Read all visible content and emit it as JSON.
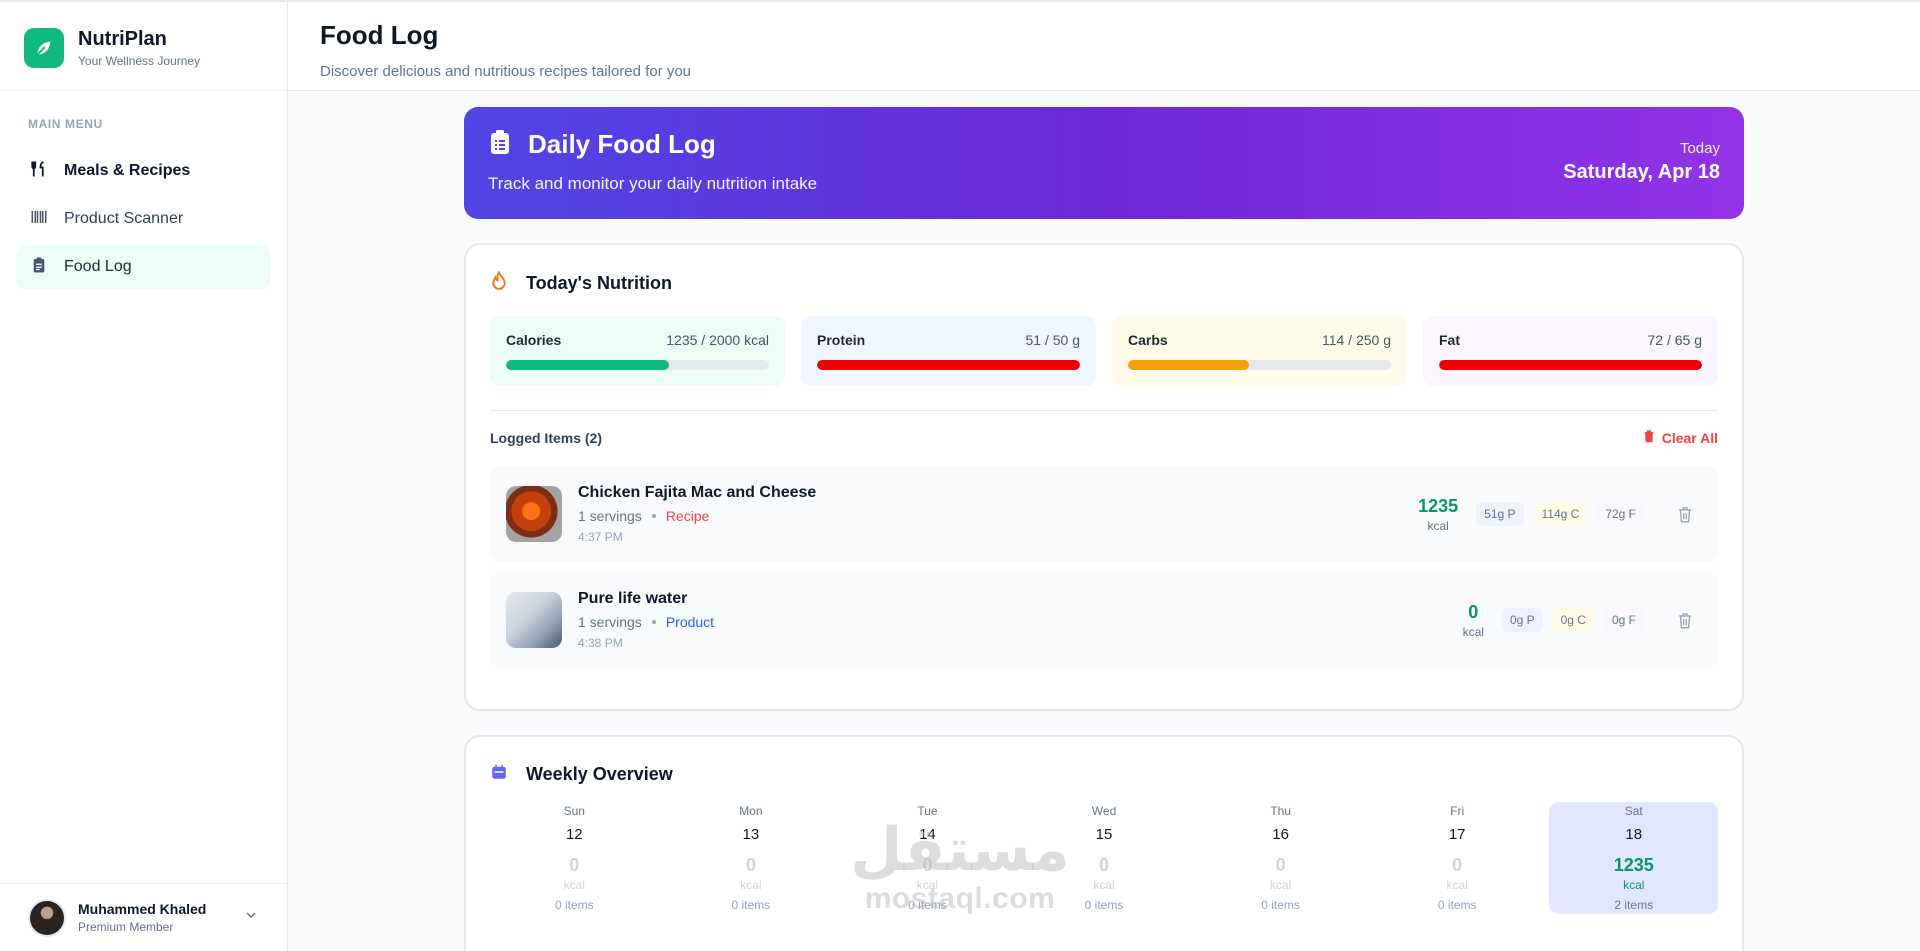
{
  "brand": {
    "name": "NutriPlan",
    "tagline": "Your Wellness Journey",
    "logo_icon": "leaf-icon",
    "accent": "#10b981"
  },
  "sidebar": {
    "heading": "MAIN MENU",
    "items": [
      {
        "label": "Meals & Recipes",
        "icon": "utensils-icon"
      },
      {
        "label": "Product Scanner",
        "icon": "barcode-icon"
      },
      {
        "label": "Food Log",
        "icon": "clipboard-icon",
        "selected": true
      }
    ],
    "user": {
      "name": "Muhammed Khaled",
      "role": "Premium Member"
    }
  },
  "header": {
    "title": "Food Log",
    "subtitle": "Discover delicious and nutritious recipes tailored for you"
  },
  "hero": {
    "title": "Daily Food Log",
    "subtitle": "Track and monitor your daily nutrition intake",
    "day_label": "Today",
    "date": "Saturday, Apr 18"
  },
  "nutrition": {
    "title": "Today's Nutrition",
    "macros": [
      {
        "name": "Calories",
        "value": "1235 / 2000 kcal",
        "progress": 0.62,
        "color": "#10b981",
        "bg": "#ecfdf5"
      },
      {
        "name": "Protein",
        "value": "51 / 50 g",
        "progress": 1.0,
        "color": "#ef0000",
        "bg": "#eff6ff"
      },
      {
        "name": "Carbs",
        "value": "114 / 250 g",
        "progress": 0.46,
        "color": "#f59e0b",
        "bg": "#fefce8"
      },
      {
        "name": "Fat",
        "value": "72 / 65 g",
        "progress": 1.0,
        "color": "#ef0000",
        "bg": "#faf5ff"
      }
    ],
    "logged_title": "Logged Items (2)",
    "clear_label": "Clear All",
    "items": [
      {
        "name": "Chicken Fajita Mac and Cheese",
        "servings": "1 servings",
        "type": "Recipe",
        "time": "4:37 PM",
        "kcal": "1235",
        "kcal_unit": "kcal",
        "p": "51g P",
        "c": "114g C",
        "f": "72g F"
      },
      {
        "name": "Pure life water",
        "servings": "1 servings",
        "type": "Product",
        "time": "4:38 PM",
        "kcal": "0",
        "kcal_unit": "kcal",
        "p": "0g P",
        "c": "0g C",
        "f": "0g F"
      }
    ]
  },
  "weekly": {
    "title": "Weekly Overview",
    "days": [
      {
        "name": "Sun",
        "num": "12",
        "kcal": "0",
        "unit": "kcal",
        "items": "0 items"
      },
      {
        "name": "Mon",
        "num": "13",
        "kcal": "0",
        "unit": "kcal",
        "items": "0 items"
      },
      {
        "name": "Tue",
        "num": "14",
        "kcal": "0",
        "unit": "kcal",
        "items": "0 items"
      },
      {
        "name": "Wed",
        "num": "15",
        "kcal": "0",
        "unit": "kcal",
        "items": "0 items"
      },
      {
        "name": "Thu",
        "num": "16",
        "kcal": "0",
        "unit": "kcal",
        "items": "0 items"
      },
      {
        "name": "Fri",
        "num": "17",
        "kcal": "0",
        "unit": "kcal",
        "items": "0 items"
      },
      {
        "name": "Sat",
        "num": "18",
        "kcal": "1235",
        "unit": "kcal",
        "items": "2 items",
        "today": true
      }
    ]
  },
  "watermark": {
    "arabic": "مستقل",
    "latin": "mostaql.com"
  }
}
